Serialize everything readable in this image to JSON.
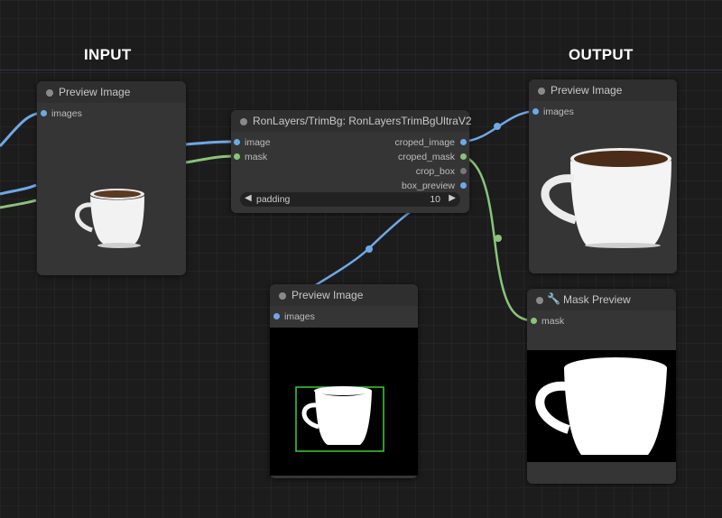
{
  "labels": {
    "input": "INPUT",
    "output": "OUTPUT"
  },
  "nodes": {
    "preview_input": {
      "title": "Preview Image",
      "inputs": [
        "images"
      ]
    },
    "trimbg": {
      "title": "RonLayers/TrimBg: RonLayersTrimBgUltraV2",
      "inputs": [
        "image",
        "mask"
      ],
      "outputs": [
        "croped_image",
        "croped_mask",
        "crop_box",
        "box_preview"
      ],
      "widget": {
        "name": "padding",
        "value": "10"
      }
    },
    "preview_box": {
      "title": "Preview Image",
      "inputs": [
        "images"
      ]
    },
    "preview_output": {
      "title": "Preview Image",
      "inputs": [
        "images"
      ]
    },
    "mask_preview": {
      "title": "Mask Preview",
      "icon": "wrench-icon",
      "inputs": [
        "mask"
      ]
    }
  },
  "colors": {
    "image_wire": "#6fa8e6",
    "mask_wire": "#89c47a",
    "node_bg": "#353535",
    "canvas_bg": "#1c1c1c"
  }
}
